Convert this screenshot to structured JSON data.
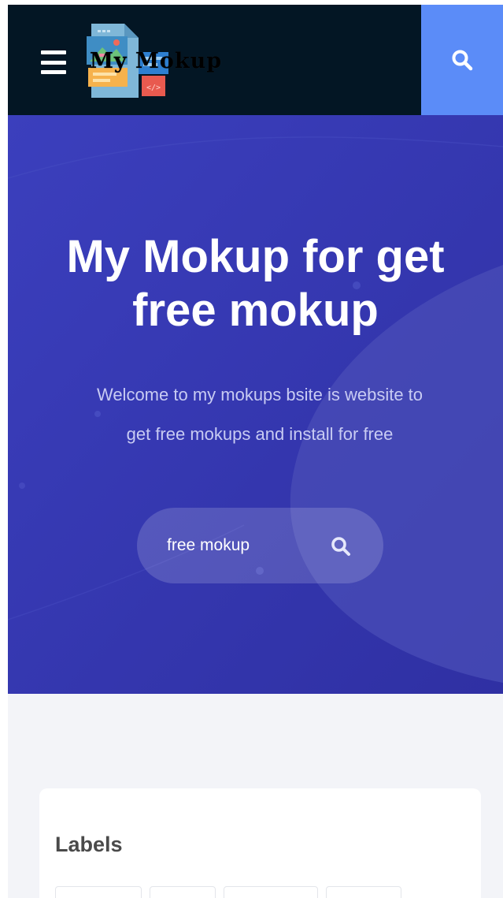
{
  "header": {
    "logo_text": "My Mokup",
    "menu_icon": "hamburger-menu-icon",
    "search_icon": "search-icon",
    "colors": {
      "background": "#031624",
      "search_button": "#5b8cf8"
    }
  },
  "hero": {
    "title_line1": "My Mokup for get",
    "title_line2": "free mokup",
    "description_line1": "Welcome to my mokups bsite is website to",
    "description_line2": "get free mokups and install for free",
    "search": {
      "value": "free mokup",
      "icon": "search-icon"
    },
    "colors": {
      "background": "#3535b0"
    }
  },
  "labels": {
    "title": "Labels",
    "items": [
      "",
      "",
      "",
      ""
    ]
  }
}
